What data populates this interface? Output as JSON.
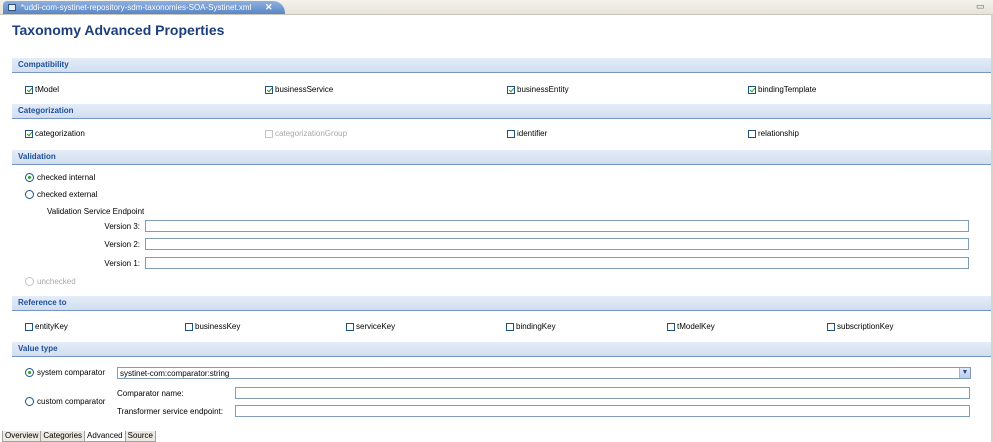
{
  "editor_tab": {
    "title": "*uddi-com-systinet-repository-sdm-taxonomies-SOA-Systinet.xml",
    "close": "✕"
  },
  "page_title": "Taxonomy Advanced Properties",
  "compatibility": {
    "heading": "Compatibility",
    "items": [
      {
        "label": "tModel",
        "checked": true
      },
      {
        "label": "businessService",
        "checked": true
      },
      {
        "label": "businessEntity",
        "checked": true
      },
      {
        "label": "bindingTemplate",
        "checked": true
      }
    ]
  },
  "categorization": {
    "heading": "Categorization",
    "items": [
      {
        "label": "categorization",
        "checked": true
      },
      {
        "label": "categorizationGroup",
        "checked": false,
        "disabled": true
      },
      {
        "label": "identifier",
        "checked": false
      },
      {
        "label": "relationship",
        "checked": false
      }
    ]
  },
  "validation": {
    "heading": "Validation",
    "checked_internal": "checked internal",
    "checked_external": "checked external",
    "endpoint_label": "Validation Service Endpoint",
    "version3_label": "Version 3:",
    "version2_label": "Version 2:",
    "version1_label": "Version 1:",
    "version3_value": "",
    "version2_value": "",
    "version1_value": "",
    "unchecked": "unchecked",
    "selected": "checked internal"
  },
  "reference_to": {
    "heading": "Reference to",
    "items": [
      {
        "label": "entityKey",
        "checked": false
      },
      {
        "label": "businessKey",
        "checked": false
      },
      {
        "label": "serviceKey",
        "checked": false
      },
      {
        "label": "bindingKey",
        "checked": false
      },
      {
        "label": "tModelKey",
        "checked": false
      },
      {
        "label": "subscriptionKey",
        "checked": false
      }
    ]
  },
  "value_type": {
    "heading": "Value type",
    "system_comparator": "system comparator",
    "system_comparator_value": "systinet-com:comparator:string",
    "custom_comparator": "custom comparator",
    "comparator_name_label": "Comparator name:",
    "comparator_name_value": "",
    "transformer_label": "Transformer service endpoint:",
    "transformer_value": "",
    "selected": "system comparator"
  },
  "bottom_tabs": [
    "Overview",
    "Categories",
    "Advanced",
    "Source"
  ],
  "active_bottom_tab": "Advanced",
  "colors": {
    "section_text": "#1f4e9a",
    "title_text": "#1c3e7a",
    "check_green": "#21a121",
    "tab_blue": "#5a86c8"
  }
}
